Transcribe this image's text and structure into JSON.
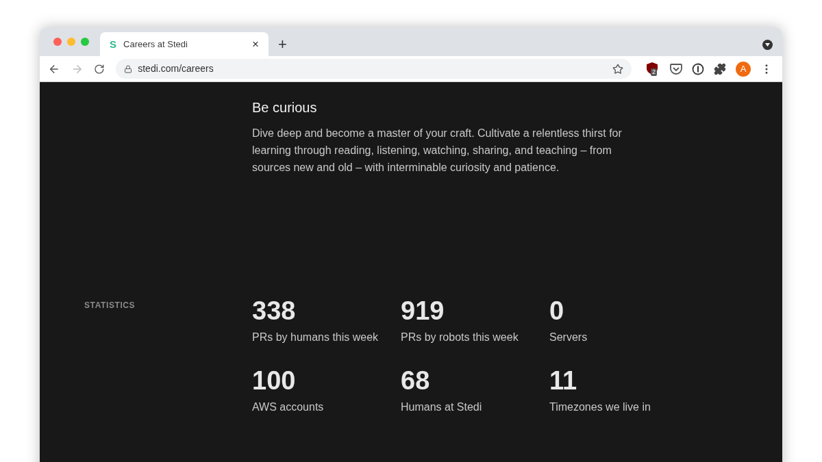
{
  "browser": {
    "tab": {
      "favicon": "S",
      "title": "Careers at Stedi",
      "close": "×"
    },
    "new_tab": "+",
    "url": "stedi.com/careers",
    "extension_badge": "2",
    "avatar": "A"
  },
  "value": {
    "title": "Be curious",
    "text": "Dive deep and become a master of your craft. Cultivate a relentless thirst for learning through reading, listening, watching, sharing, and teaching – from sources new and old – with interminable curiosity and patience."
  },
  "statistics": {
    "label": "STATISTICS",
    "items": [
      {
        "value": "338",
        "label": "PRs by humans this week"
      },
      {
        "value": "919",
        "label": "PRs by robots this week"
      },
      {
        "value": "0",
        "label": "Servers"
      },
      {
        "value": "100",
        "label": "AWS accounts"
      },
      {
        "value": "68",
        "label": "Humans at Stedi"
      },
      {
        "value": "11",
        "label": "Timezones we live in"
      }
    ]
  }
}
